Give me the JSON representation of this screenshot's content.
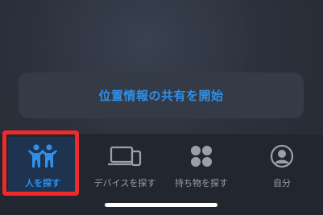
{
  "share_card": {
    "label": "位置情報の共有を開始"
  },
  "tabs": [
    {
      "label": "人を探す",
      "icon": "people-icon",
      "active": true
    },
    {
      "label": "デバイスを探す",
      "icon": "devices-icon",
      "active": false
    },
    {
      "label": "持ち物を探す",
      "icon": "items-icon",
      "active": false
    },
    {
      "label": "自分",
      "icon": "me-icon",
      "active": false
    }
  ],
  "colors": {
    "accent": "#2f8fe8",
    "highlight": "#ee2a2a",
    "inactive": "#9aa0aa"
  }
}
